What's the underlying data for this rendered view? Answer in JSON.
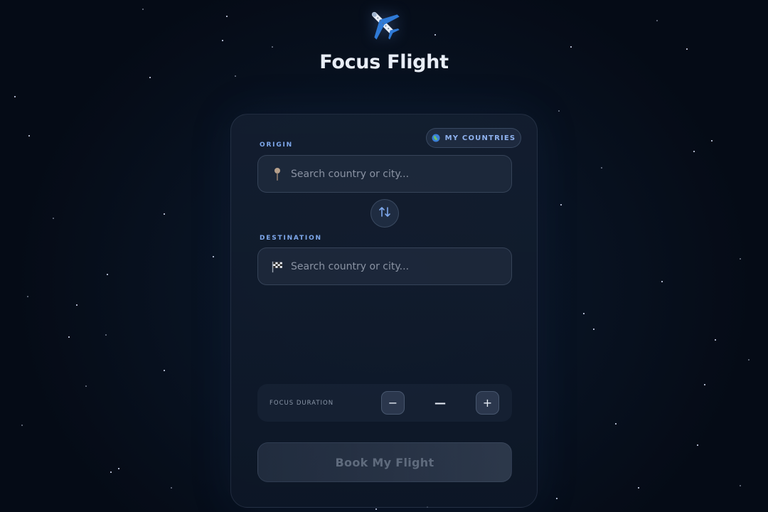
{
  "app": {
    "title": "Focus Flight",
    "logo_icon": "airplane-icon"
  },
  "header": {
    "countries_button_label": "MY COUNTRIES",
    "countries_icon": "globe-icon"
  },
  "origin": {
    "label": "ORIGIN",
    "placeholder": "Search country or city...",
    "value": "",
    "icon": "pin-icon"
  },
  "swap": {
    "icon": "swap-arrows-icon"
  },
  "destination": {
    "label": "DESTINATION",
    "placeholder": "Search country or city...",
    "value": "",
    "icon": "checkered-flag-icon"
  },
  "duration": {
    "label": "FOCUS DURATION",
    "minus_label": "−",
    "plus_label": "+",
    "value": "—"
  },
  "book": {
    "label": "Book My Flight"
  },
  "colors": {
    "accent": "#7ea8ec",
    "background": "#081221",
    "card": "#101c2e"
  }
}
